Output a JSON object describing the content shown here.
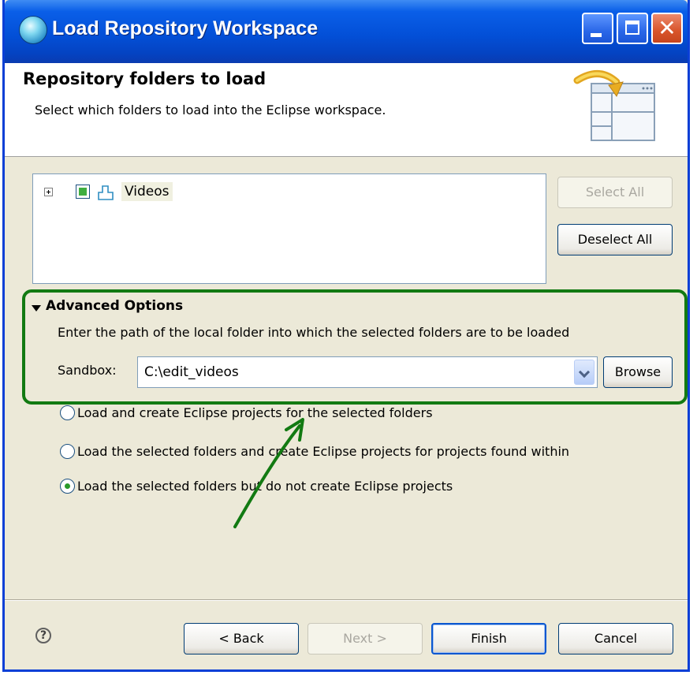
{
  "window": {
    "title": "Load Repository Workspace",
    "icon": "repository-globe-icon"
  },
  "header": {
    "title": "Repository folders to load",
    "description": "Select which folders to load into the Eclipse workspace.",
    "icon": "wizard-banner-icon"
  },
  "tree": {
    "items": [
      {
        "label": "Videos",
        "checked": true,
        "expandable": true,
        "icon": "component-icon"
      }
    ]
  },
  "side_buttons": {
    "select_all": "Select All",
    "deselect_all": "Deselect All"
  },
  "advanced": {
    "title": "Advanced Options",
    "description": "Enter the path of the local folder into which the selected folders are to be loaded",
    "sandbox_label": "Sandbox:",
    "sandbox_value": "C:\\edit_videos",
    "browse": "Browse"
  },
  "load_options": [
    {
      "label": "Load and create Eclipse projects for the selected folders",
      "selected": false
    },
    {
      "label": "Load the selected folders and create Eclipse projects for projects found within",
      "selected": false
    },
    {
      "label": "Load the selected folders but do not create Eclipse projects",
      "selected": true
    }
  ],
  "footer": {
    "help": "?",
    "back": "< Back",
    "next": "Next >",
    "finish": "Finish",
    "cancel": "Cancel"
  },
  "colors": {
    "titlebar": "#0350d8",
    "annotation": "#127a12",
    "checked_mark": "#3fae3f"
  }
}
